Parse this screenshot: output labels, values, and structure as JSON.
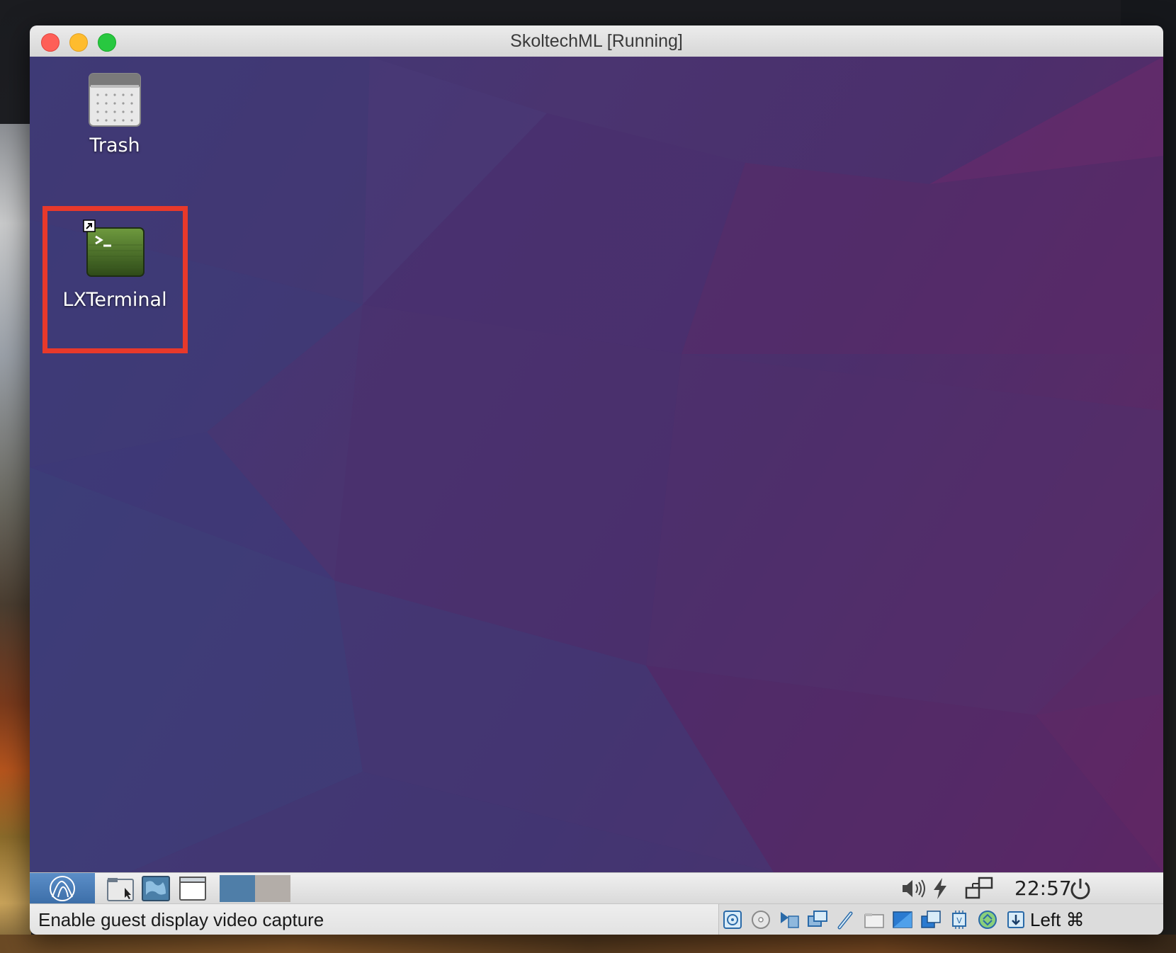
{
  "window": {
    "title": "SkoltechML [Running]",
    "traffic_lights": [
      "close",
      "minimize",
      "maximize"
    ]
  },
  "desktop": {
    "icons": [
      {
        "label": "Trash",
        "icon": "trash-icon"
      },
      {
        "label": "LXTerminal",
        "icon": "terminal-icon",
        "shortcut_overlay": "symlink-arrow-icon"
      }
    ],
    "highlight_color": "#e8392b"
  },
  "panel": {
    "menu_icon": "lxde-logo-icon",
    "launchers": [
      "file-manager-icon",
      "web-browser-icon",
      "window-icon"
    ],
    "workspaces": [
      {
        "color": "#4f7ea8"
      },
      {
        "color": "#b3ada8"
      }
    ],
    "tray": [
      "volume-icon",
      "power-lightning-icon",
      "network-icon"
    ],
    "clock": "22:57",
    "shutdown_icon": "power-icon"
  },
  "statusbar": {
    "message": "Enable guest display video capture",
    "icons": [
      "hard-disk-icon",
      "optical-disk-icon",
      "audio-icon",
      "network-adapter-icon",
      "usb-icon",
      "shared-folder-icon",
      "display-icon",
      "recording-icon",
      "cpu-icon",
      "mouse-integration-icon",
      "keyboard-icon"
    ],
    "host_key": "Left ⌘"
  }
}
